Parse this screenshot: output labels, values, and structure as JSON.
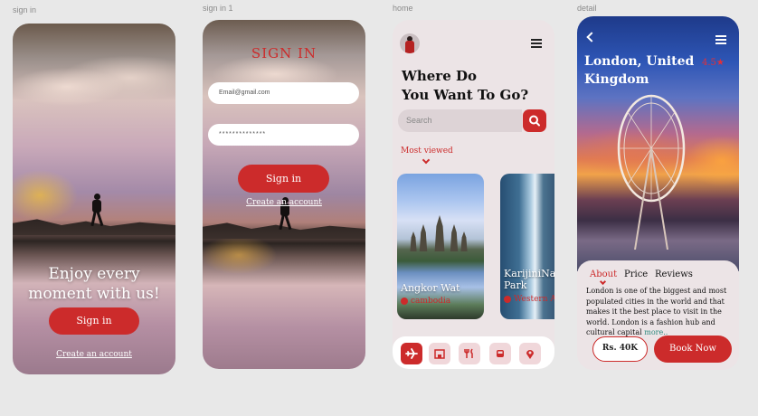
{
  "frame_labels": {
    "sign_in": "sign in",
    "sign_in_1": "sign in 1",
    "home": "home",
    "detail": "detail"
  },
  "screen1": {
    "headline_1": "Enjoy every",
    "headline_2": "moment with us!",
    "sign_in_button": "Sign in",
    "create_account": "Create an account"
  },
  "screen2": {
    "title": "SIGN IN",
    "email_value": "Email@gmail.com",
    "password_value": "**************",
    "sign_in_button": "Sign in",
    "create_account": "Create an account"
  },
  "screen3": {
    "title_1": "Where Do",
    "title_2": "You Want To Go?",
    "search_placeholder": "Search",
    "most_viewed": "Most viewed",
    "cards": [
      {
        "name_1": "Angkor Wat",
        "name_2": "",
        "location": "cambodia"
      },
      {
        "name_1": "KarijiniNa",
        "name_2": "Park",
        "location": "Western A"
      }
    ],
    "nav": [
      "plane-icon",
      "hotel-icon",
      "restaurant-icon",
      "car-icon",
      "location-icon"
    ]
  },
  "screen4": {
    "title_1": "London, United",
    "title_2": "Kingdom",
    "rating": "4.5★",
    "tabs": {
      "about": "About",
      "price": "Price",
      "reviews": "Reviews"
    },
    "description": "London is one of the biggest and most populated cities in the world and that makes it the best place to visit in the world. London is a fashion hub and cultural capital",
    "more": "more..",
    "price": "Rs. 40K",
    "book_button": "Book Now"
  },
  "colors": {
    "accent": "#cc2b2b",
    "background": "#e8e8e8",
    "panel": "#ece4e6"
  }
}
